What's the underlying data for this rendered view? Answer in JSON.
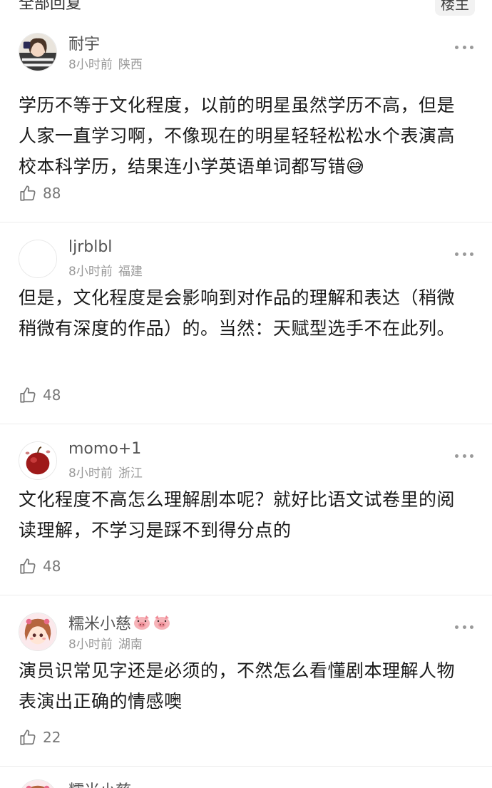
{
  "header": {
    "title": "全部回复",
    "op_button": "楼主"
  },
  "comments": [
    {
      "username": "耐宇",
      "time": "8小时前",
      "location": "陕西",
      "text": "学历不等于文化程度，以前的明星虽然学历不高，但是人家一直学习啊，不像现在的明星轻轻松松水个表演高校本科学历，结果连小学英语单词都写错😅",
      "likes": "88"
    },
    {
      "username": "ljrblbl",
      "time": "8小时前",
      "location": "福建",
      "text": "但是，文化程度是会影响到对作品的理解和表达（稍微稍微有深度的作品）的。当然：天赋型选手不在此列。",
      "likes": "48"
    },
    {
      "username": "momo+1",
      "time": "8小时前",
      "location": "浙江",
      "text": "文化程度不高怎么理解剧本呢？就好比语文试卷里的阅读理解，不学习是踩不到得分点的",
      "likes": "48"
    },
    {
      "username": "糯米小慈",
      "time": "8小时前",
      "location": "湖南",
      "text": "演员识常见字还是必须的，不然怎么看懂剧本理解人物表演出正确的情感噢",
      "likes": "22",
      "name_badges": [
        "pig-face-icon",
        "pig-face-icon"
      ]
    }
  ],
  "partial_next": {
    "username": "糯米小慈"
  }
}
